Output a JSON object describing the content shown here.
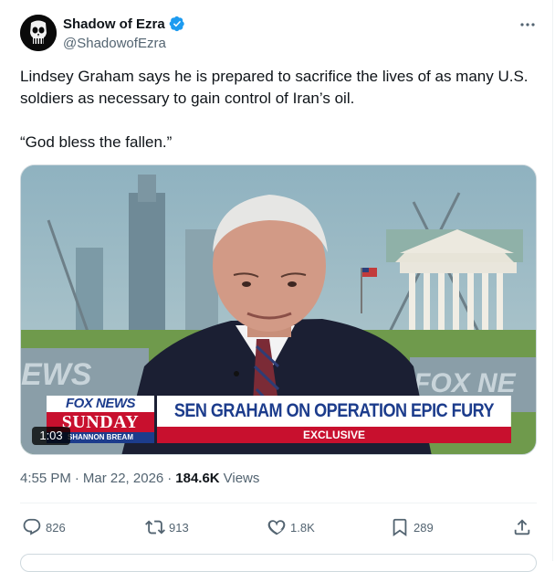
{
  "author": {
    "name": "Shadow of Ezra",
    "handle": "@ShadowofEzra",
    "verified": true,
    "avatar_icon": "punisher-skull-icon"
  },
  "tweet": {
    "text": "Lindsey Graham says he is prepared to sacrifice the lives of as many U.S. soldiers as necessary to gain control of Iran’s oil.\n\n“God bless the fallen.”"
  },
  "video": {
    "duration": "1:03",
    "bug_left_top": "FOX NEWS",
    "bug_left_mid": "SUNDAY",
    "bug_left_bottom": "SHANNON BREAM",
    "headline": "SEN GRAHAM ON OPERATION EPIC FURY",
    "subheadline": "EXCLUSIVE",
    "wall_text_left": "EWS",
    "wall_text_right": "FOX NE"
  },
  "meta": {
    "time": "4:55 PM",
    "sep1": "·",
    "date": "Mar 22, 2026",
    "sep2": "·",
    "views_count": "184.6K",
    "views_label": "Views"
  },
  "actions": {
    "replies": "826",
    "reposts": "913",
    "likes": "1.8K",
    "bookmarks": "289"
  },
  "colors": {
    "text_primary": "#0f1419",
    "text_secondary": "#536471",
    "verified_blue": "#1d9bf0",
    "fox_red": "#c8102e",
    "fox_blue": "#1c3c8c"
  }
}
